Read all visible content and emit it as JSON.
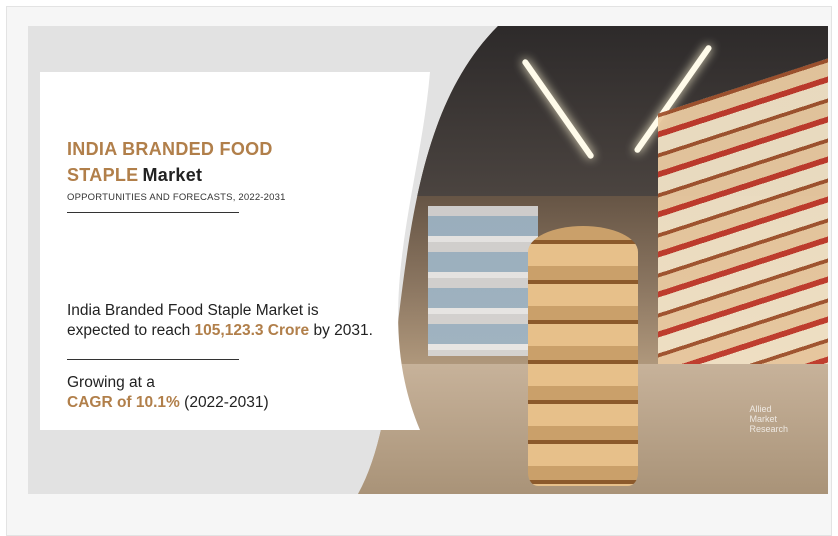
{
  "title": {
    "line1": "INDIA BRANDED FOOD",
    "line2_accent": "STAPLE",
    "line2_dark": "Market"
  },
  "subtitle": "OPPORTUNITIES AND FORECASTS, 2022-2031",
  "stat_reach": {
    "line1": "India Branded Food Staple Market is",
    "prefix": "expected to reach",
    "value": "105,123.3 Crore",
    "suffix": "by 2031."
  },
  "stat_growth": {
    "line1": "Growing at a",
    "value": "CAGR of 10.1%",
    "suffix": "(2022-2031)"
  },
  "watermark": {
    "line1": "Allied",
    "line2": "Market",
    "line3": "Research"
  },
  "colors": {
    "accent": "#b17f4a",
    "text": "#222222",
    "background": "#e2e2e2"
  }
}
